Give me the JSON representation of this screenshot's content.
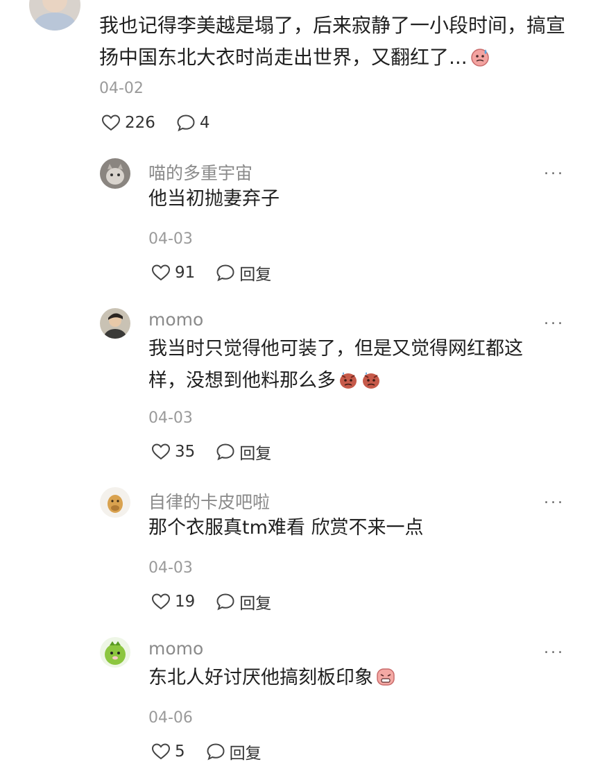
{
  "main_comment": {
    "text": "我也记得李美越是塌了，后来寂静了一小段时间，搞宣扬中国东北大衣时尚走出世界，又翻红了...",
    "emoji_icon": "sweating-face-emoji",
    "date": "04-02",
    "likes": "226",
    "comments": "4"
  },
  "replies": [
    {
      "username": "喵的多重宇宙",
      "text": "他当初抛妻弃子",
      "emojis": [],
      "date": "04-03",
      "likes": "91",
      "reply_label": "回复",
      "avatar_icon": "cat-avatar"
    },
    {
      "username": "momo",
      "text": "我当时只觉得他可装了，但是又觉得网红都这样，没想到他料那么多",
      "emojis": [
        "angry-face-emoji",
        "angry-face-emoji"
      ],
      "date": "04-03",
      "likes": "35",
      "reply_label": "回复",
      "avatar_icon": "person-avatar"
    },
    {
      "username": "自律的卡皮吧啦",
      "text": "那个衣服真tm难看 欣赏不来一点",
      "emojis": [],
      "date": "04-03",
      "likes": "19",
      "reply_label": "回复",
      "avatar_icon": "capybara-avatar"
    },
    {
      "username": "momo",
      "text": "东北人好讨厌他搞刻板印象",
      "emojis": [
        "disgusted-face-emoji"
      ],
      "date": "04-06",
      "likes": "5",
      "reply_label": "回复",
      "avatar_icon": "green-cartoon-avatar"
    }
  ],
  "more_label": "...",
  "colors": {
    "text_primary": "#1f1f1f",
    "text_secondary": "#8a8a8a",
    "date": "#9a9a9a",
    "background": "#ffffff"
  }
}
